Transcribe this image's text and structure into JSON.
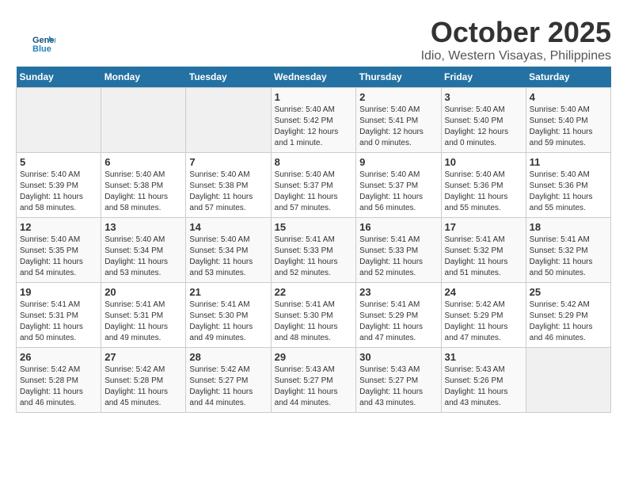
{
  "logo": {
    "line1": "General",
    "line2": "Blue"
  },
  "title": "October 2025",
  "subtitle": "Idio, Western Visayas, Philippines",
  "days_of_week": [
    "Sunday",
    "Monday",
    "Tuesday",
    "Wednesday",
    "Thursday",
    "Friday",
    "Saturday"
  ],
  "weeks": [
    [
      {
        "day": "",
        "sunrise": "",
        "sunset": "",
        "daylight": ""
      },
      {
        "day": "",
        "sunrise": "",
        "sunset": "",
        "daylight": ""
      },
      {
        "day": "",
        "sunrise": "",
        "sunset": "",
        "daylight": ""
      },
      {
        "day": "1",
        "sunrise": "Sunrise: 5:40 AM",
        "sunset": "Sunset: 5:42 PM",
        "daylight": "Daylight: 12 hours and 1 minute."
      },
      {
        "day": "2",
        "sunrise": "Sunrise: 5:40 AM",
        "sunset": "Sunset: 5:41 PM",
        "daylight": "Daylight: 12 hours and 0 minutes."
      },
      {
        "day": "3",
        "sunrise": "Sunrise: 5:40 AM",
        "sunset": "Sunset: 5:40 PM",
        "daylight": "Daylight: 12 hours and 0 minutes."
      },
      {
        "day": "4",
        "sunrise": "Sunrise: 5:40 AM",
        "sunset": "Sunset: 5:40 PM",
        "daylight": "Daylight: 11 hours and 59 minutes."
      }
    ],
    [
      {
        "day": "5",
        "sunrise": "Sunrise: 5:40 AM",
        "sunset": "Sunset: 5:39 PM",
        "daylight": "Daylight: 11 hours and 58 minutes."
      },
      {
        "day": "6",
        "sunrise": "Sunrise: 5:40 AM",
        "sunset": "Sunset: 5:38 PM",
        "daylight": "Daylight: 11 hours and 58 minutes."
      },
      {
        "day": "7",
        "sunrise": "Sunrise: 5:40 AM",
        "sunset": "Sunset: 5:38 PM",
        "daylight": "Daylight: 11 hours and 57 minutes."
      },
      {
        "day": "8",
        "sunrise": "Sunrise: 5:40 AM",
        "sunset": "Sunset: 5:37 PM",
        "daylight": "Daylight: 11 hours and 57 minutes."
      },
      {
        "day": "9",
        "sunrise": "Sunrise: 5:40 AM",
        "sunset": "Sunset: 5:37 PM",
        "daylight": "Daylight: 11 hours and 56 minutes."
      },
      {
        "day": "10",
        "sunrise": "Sunrise: 5:40 AM",
        "sunset": "Sunset: 5:36 PM",
        "daylight": "Daylight: 11 hours and 55 minutes."
      },
      {
        "day": "11",
        "sunrise": "Sunrise: 5:40 AM",
        "sunset": "Sunset: 5:36 PM",
        "daylight": "Daylight: 11 hours and 55 minutes."
      }
    ],
    [
      {
        "day": "12",
        "sunrise": "Sunrise: 5:40 AM",
        "sunset": "Sunset: 5:35 PM",
        "daylight": "Daylight: 11 hours and 54 minutes."
      },
      {
        "day": "13",
        "sunrise": "Sunrise: 5:40 AM",
        "sunset": "Sunset: 5:34 PM",
        "daylight": "Daylight: 11 hours and 53 minutes."
      },
      {
        "day": "14",
        "sunrise": "Sunrise: 5:40 AM",
        "sunset": "Sunset: 5:34 PM",
        "daylight": "Daylight: 11 hours and 53 minutes."
      },
      {
        "day": "15",
        "sunrise": "Sunrise: 5:41 AM",
        "sunset": "Sunset: 5:33 PM",
        "daylight": "Daylight: 11 hours and 52 minutes."
      },
      {
        "day": "16",
        "sunrise": "Sunrise: 5:41 AM",
        "sunset": "Sunset: 5:33 PM",
        "daylight": "Daylight: 11 hours and 52 minutes."
      },
      {
        "day": "17",
        "sunrise": "Sunrise: 5:41 AM",
        "sunset": "Sunset: 5:32 PM",
        "daylight": "Daylight: 11 hours and 51 minutes."
      },
      {
        "day": "18",
        "sunrise": "Sunrise: 5:41 AM",
        "sunset": "Sunset: 5:32 PM",
        "daylight": "Daylight: 11 hours and 50 minutes."
      }
    ],
    [
      {
        "day": "19",
        "sunrise": "Sunrise: 5:41 AM",
        "sunset": "Sunset: 5:31 PM",
        "daylight": "Daylight: 11 hours and 50 minutes."
      },
      {
        "day": "20",
        "sunrise": "Sunrise: 5:41 AM",
        "sunset": "Sunset: 5:31 PM",
        "daylight": "Daylight: 11 hours and 49 minutes."
      },
      {
        "day": "21",
        "sunrise": "Sunrise: 5:41 AM",
        "sunset": "Sunset: 5:30 PM",
        "daylight": "Daylight: 11 hours and 49 minutes."
      },
      {
        "day": "22",
        "sunrise": "Sunrise: 5:41 AM",
        "sunset": "Sunset: 5:30 PM",
        "daylight": "Daylight: 11 hours and 48 minutes."
      },
      {
        "day": "23",
        "sunrise": "Sunrise: 5:41 AM",
        "sunset": "Sunset: 5:29 PM",
        "daylight": "Daylight: 11 hours and 47 minutes."
      },
      {
        "day": "24",
        "sunrise": "Sunrise: 5:42 AM",
        "sunset": "Sunset: 5:29 PM",
        "daylight": "Daylight: 11 hours and 47 minutes."
      },
      {
        "day": "25",
        "sunrise": "Sunrise: 5:42 AM",
        "sunset": "Sunset: 5:29 PM",
        "daylight": "Daylight: 11 hours and 46 minutes."
      }
    ],
    [
      {
        "day": "26",
        "sunrise": "Sunrise: 5:42 AM",
        "sunset": "Sunset: 5:28 PM",
        "daylight": "Daylight: 11 hours and 46 minutes."
      },
      {
        "day": "27",
        "sunrise": "Sunrise: 5:42 AM",
        "sunset": "Sunset: 5:28 PM",
        "daylight": "Daylight: 11 hours and 45 minutes."
      },
      {
        "day": "28",
        "sunrise": "Sunrise: 5:42 AM",
        "sunset": "Sunset: 5:27 PM",
        "daylight": "Daylight: 11 hours and 44 minutes."
      },
      {
        "day": "29",
        "sunrise": "Sunrise: 5:43 AM",
        "sunset": "Sunset: 5:27 PM",
        "daylight": "Daylight: 11 hours and 44 minutes."
      },
      {
        "day": "30",
        "sunrise": "Sunrise: 5:43 AM",
        "sunset": "Sunset: 5:27 PM",
        "daylight": "Daylight: 11 hours and 43 minutes."
      },
      {
        "day": "31",
        "sunrise": "Sunrise: 5:43 AM",
        "sunset": "Sunset: 5:26 PM",
        "daylight": "Daylight: 11 hours and 43 minutes."
      },
      {
        "day": "",
        "sunrise": "",
        "sunset": "",
        "daylight": ""
      }
    ]
  ]
}
